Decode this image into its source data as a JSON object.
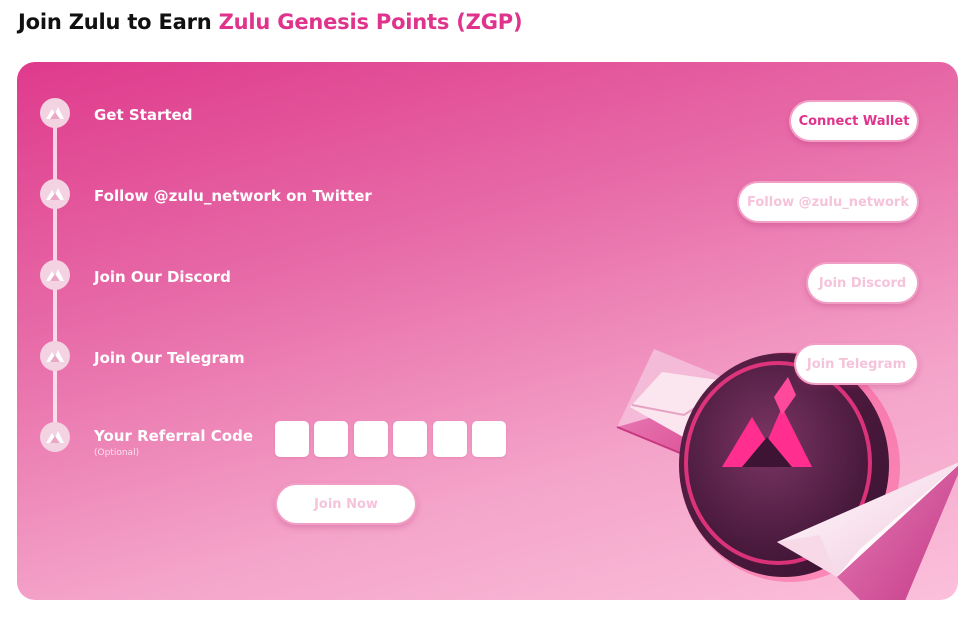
{
  "page": {
    "title_prefix": "Join Zulu to Earn ",
    "title_accent": "Zulu Genesis Points (ZGP)",
    "accent_color": "#e0338b"
  },
  "steps": [
    {
      "label": "Get Started",
      "icon": "zulu-logo-icon"
    },
    {
      "label": "Follow @zulu_network on Twitter",
      "icon": "zulu-logo-icon"
    },
    {
      "label": "Join Our Discord",
      "icon": "zulu-logo-icon"
    },
    {
      "label": "Join Our Telegram",
      "icon": "zulu-logo-icon"
    },
    {
      "label": "Your Referral Code",
      "sublabel": "(Optional)",
      "icon": "zulu-logo-icon"
    }
  ],
  "buttons": {
    "connect_wallet": "Connect Wallet",
    "follow_twitter": "Follow @zulu_network",
    "join_discord": "Join Discord",
    "join_telegram": "Join Telegram",
    "join_now": "Join Now"
  },
  "referral_code": {
    "boxes": [
      "",
      "",
      "",
      "",
      "",
      ""
    ]
  },
  "illustration": {
    "icons": [
      "envelope-icon",
      "zulu-coin-icon",
      "paper-plane-icon"
    ]
  }
}
